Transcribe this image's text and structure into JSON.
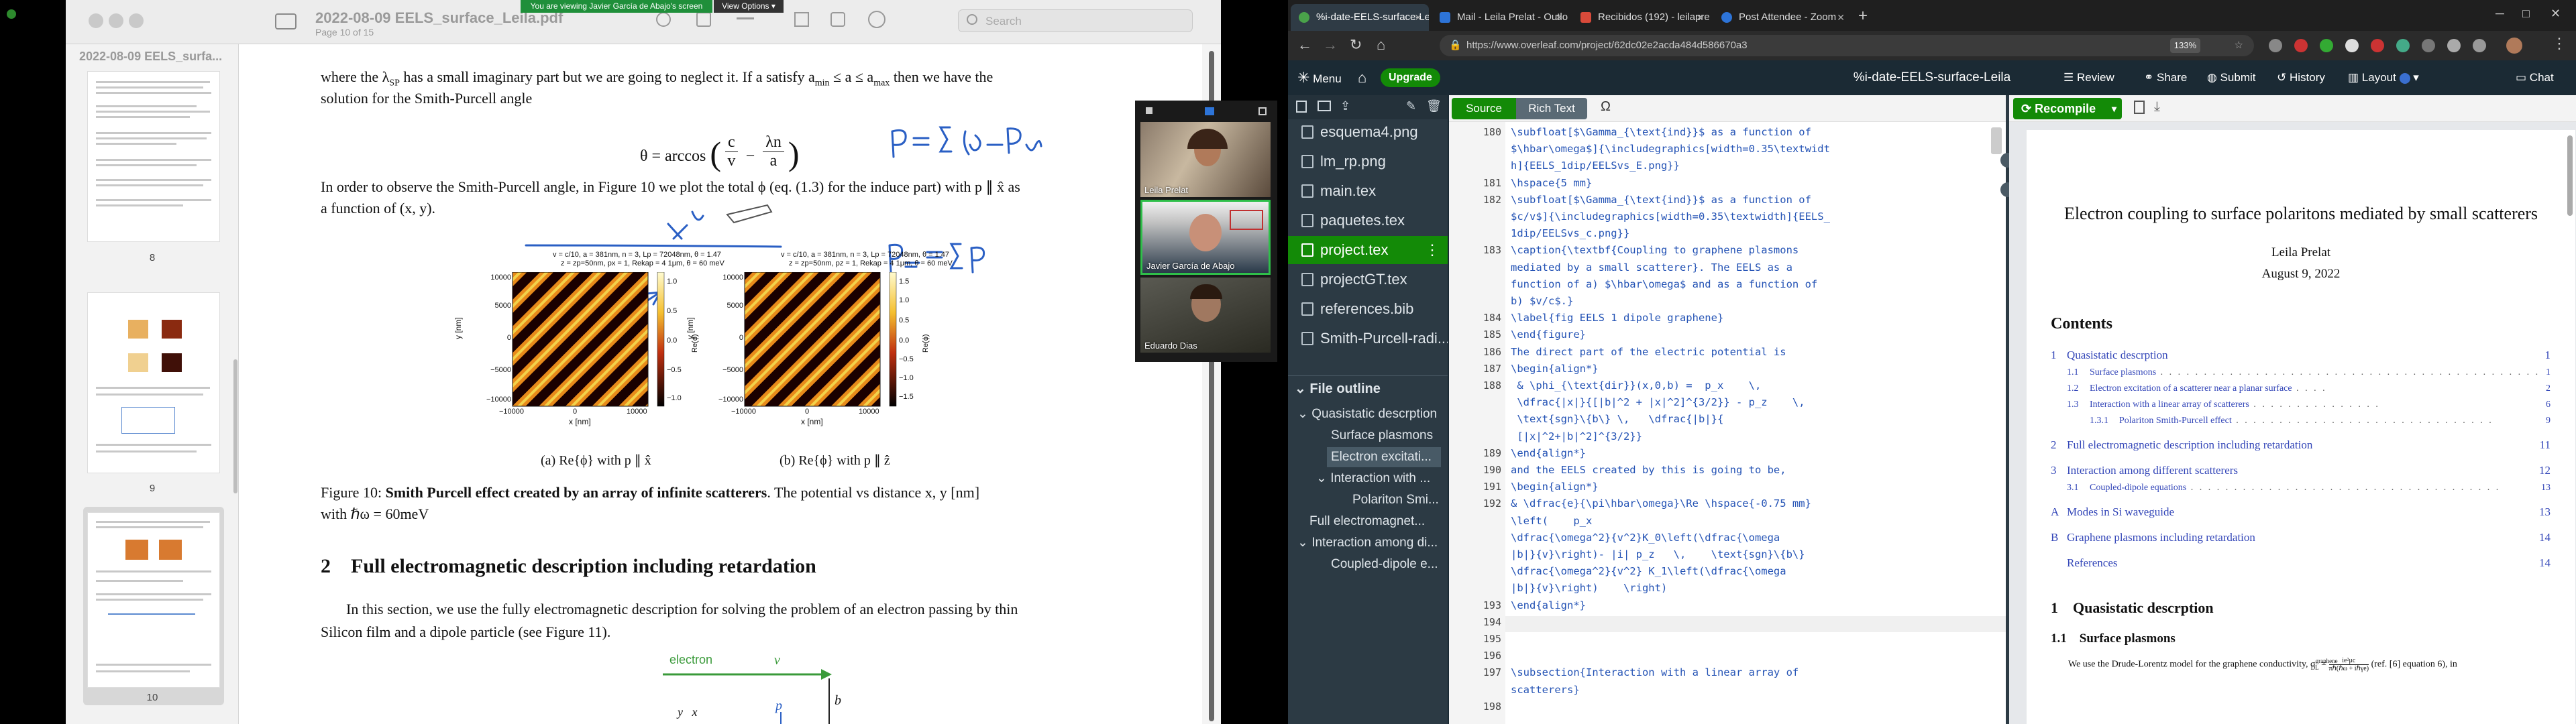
{
  "pdf": {
    "title": "2022-08-09 EELS_surface_Leila.pdf",
    "subtitle": "Page 10 of 15",
    "search_placeholder": "Search",
    "sidebar_title": "2022-08-09 EELS_surfa...",
    "thumb_labels": [
      "8",
      "9",
      "10"
    ],
    "page": {
      "p1": "where the λ",
      "p1b": "SP",
      "p1c": " has a small imaginary part but we are going to neglect it. If a satisfy a",
      "p1d": "min",
      "p1e": " ≤ a ≤ a",
      "p1f": "max",
      "p1g": " then we have the",
      "p2": "solution for the Smith-Purcell angle",
      "eq_lhs": "θ = arccos",
      "eq_frac1_num": "c",
      "eq_frac1_den": "v",
      "eq_minus": "−",
      "eq_frac2_num": "λn",
      "eq_frac2_den": "a",
      "p3": "In order to observe the Smith-Purcell angle, in Figure 10 we plot the total ϕ (eq. (1.3) for the induce part) with p ∥ x̂ as",
      "p4": "a function of (x, y).",
      "plot_a_title1": "v = c/10, a = 381nm, n = 3, Lp = 72048nm, θ = 1.47",
      "plot_a_title2": "z = zp=50nm, px = 1, Rekap = 4 1μm, θ = 60 meV",
      "plot_b_title1": "v = c/10, a = 381nm, n = 3, Lp = 72048nm, θ = 1.47",
      "plot_b_title2": "z = zp=50nm, pz = 1, Rekap = 4 1μm, θ = 60 meV",
      "yticks": [
        "10000",
        "5000",
        "0",
        "−5000",
        "−10000"
      ],
      "xticks": [
        "−10000",
        "0",
        "10000"
      ],
      "cbar_a": [
        "1.0",
        "0.5",
        "0.0",
        "−0.5",
        "−1.0"
      ],
      "cbar_b": [
        "1.5",
        "1.0",
        "0.5",
        "0.0",
        "−0.5",
        "−1.0",
        "−1.5"
      ],
      "cbar_label": "Re(ϕ)",
      "ylabel": "y [nm]",
      "xlabel": "x [nm]",
      "cap_a": "(a) Re{ϕ} with p ∥ x̂",
      "cap_b": "(b) Re{ϕ} with p ∥ ẑ",
      "fig_lead": "Figure 10: ",
      "fig_bold": "Smith Purcell effect created by an array of infinite scatterers",
      "fig_rest": ". The potential vs distance x, y [nm]",
      "fig_line2": "with ℏω = 60meV",
      "section": "2    Full electromagnetic description including retardation",
      "p5": "In this section, we use the fully electromagnetic description for solving the problem of an electron passing by thin",
      "p6": "Silicon film and a dipole particle (see Figure 11).",
      "fig11_electron": "electron",
      "fig11_v": "v",
      "fig11_b": "b",
      "fig11_p": "p",
      "fig11_yx": "y   x"
    }
  },
  "zoom": {
    "banner": "You are viewing Javier García de Abajo's screen",
    "view_options": "View Options ▾",
    "participants": [
      "Leila Prelat",
      "Javier García de Abajo",
      "Eduardo Dias"
    ]
  },
  "browser": {
    "tabs": [
      "%i-date-EELS-surface-Le",
      "Mail - Leila Prelat - Outlo",
      "Recibidos (192) - leilapre",
      "Post Attendee - Zoom"
    ],
    "url": "https://www.overleaf.com/project/62dc02e2acda484d586670a3",
    "zoom_level": "133%"
  },
  "overleaf": {
    "menu": "Menu",
    "upgrade": "Upgrade",
    "project_title": "%i-date-EELS-surface-Leila",
    "review": "Review",
    "share": "Share",
    "submit": "Submit",
    "history": "History",
    "layout": "Layout",
    "chat": "Chat",
    "source": "Source",
    "rich_text": "Rich Text",
    "omega": "Ω",
    "recompile": "Recompile",
    "files": [
      "esquema4.png",
      "lm_rp.png",
      "main.tex",
      "paquetes.tex",
      "project.tex",
      "projectGT.tex",
      "references.bib",
      "Smith-Purcell-radi..."
    ],
    "file_outline": "File outline",
    "outline": [
      "Quasistatic descrption",
      "Surface plasmons",
      "Electron excitati...",
      "Interaction with ...",
      "Polariton Smi...",
      "Full electromagnet...",
      "Interaction among di...",
      "Coupled-dipole e..."
    ]
  },
  "code": {
    "lines": [
      {
        "n": "180",
        "t": "\\subfloat[$\\Gamma_{\\text{ind}}$ as a function of"
      },
      {
        "n": "",
        "t": "$\\hbar\\omega$]{\\includegraphics[width=0.35\\textwidt"
      },
      {
        "n": "",
        "t": "h]{EELS_1dip/EELSvs_E.png}}"
      },
      {
        "n": "181",
        "t": "\\hspace{5 mm}"
      },
      {
        "n": "182",
        "t": "\\subfloat[$\\Gamma_{\\text{ind}}$ as a function of"
      },
      {
        "n": "",
        "t": "$c/v$]{\\includegraphics[width=0.35\\textwidth]{EELS_"
      },
      {
        "n": "",
        "t": "1dip/EELSvs_c.png}}"
      },
      {
        "n": "183",
        "t": "\\caption{\\textbf{Coupling to graphene plasmons"
      },
      {
        "n": "",
        "t": "mediated by a small scatterer}. The EELS as a"
      },
      {
        "n": "",
        "t": "function of a) $\\hbar\\omega$ and as a function of"
      },
      {
        "n": "",
        "t": "b) $v/c$.}"
      },
      {
        "n": "184",
        "t": "\\label{fig EELS 1 dipole graphene}"
      },
      {
        "n": "185",
        "t": "\\end{figure}"
      },
      {
        "n": "186",
        "t": "The direct part of the electric potential is"
      },
      {
        "n": "187",
        "t": "\\begin{align*}"
      },
      {
        "n": "188",
        "t": " & \\phi_{\\text{dir}}(x,0,b) =  p_x    \\,"
      },
      {
        "n": "",
        "t": " \\dfrac{|x|}{[|b|^2 + |x|^2]^{3/2}} - p_z    \\,"
      },
      {
        "n": "",
        "t": " \\text{sgn}\\{b\\} \\,   \\dfrac{|b|}{"
      },
      {
        "n": "",
        "t": " [|x|^2+|b|^2]^{3/2}}"
      },
      {
        "n": "189",
        "t": "\\end{align*}"
      },
      {
        "n": "190",
        "t": "and the EELS created by this is going to be,"
      },
      {
        "n": "191",
        "t": "\\begin{align*}"
      },
      {
        "n": "192",
        "t": "& \\dfrac{e}{\\pi\\hbar\\omega}\\Re \\hspace{-0.75 mm}"
      },
      {
        "n": "",
        "t": "\\left(    p_x"
      },
      {
        "n": "",
        "t": "\\dfrac{\\omega^2}{v^2}K_0\\left(\\dfrac{\\omega"
      },
      {
        "n": "",
        "t": "|b|}{v}\\right)- |i| p_z   \\,    \\text{sgn}\\{b\\}"
      },
      {
        "n": "",
        "t": "\\dfrac{\\omega^2}{v^2} K_1\\left(\\dfrac{\\omega"
      },
      {
        "n": "",
        "t": "|b|}{v}\\right)    \\right)"
      },
      {
        "n": "193",
        "t": "\\end{align*}"
      },
      {
        "n": "194",
        "t": ""
      },
      {
        "n": "195",
        "t": ""
      },
      {
        "n": "196",
        "t": ""
      },
      {
        "n": "197",
        "t": "\\subsection{Interaction with a linear array of"
      },
      {
        "n": "",
        "t": "scatterers}"
      },
      {
        "n": "198",
        "t": ""
      }
    ]
  },
  "preview": {
    "title": "Electron coupling to surface polaritons mediated by small scatterers",
    "author": "Leila Prelat",
    "date": "August 9, 2022",
    "contents": "Contents",
    "toc": [
      {
        "num": "1",
        "t": "Quasistatic descrption",
        "p": "1",
        "lvl": 0
      },
      {
        "num": "1.1",
        "t": "Surface plasmons",
        "p": "1",
        "lvl": 1
      },
      {
        "num": "1.2",
        "t": "Electron excitation of a scatterer near a planar surface",
        "p": "2",
        "lvl": 1
      },
      {
        "num": "1.3",
        "t": "Interaction with a linear array of scatterers",
        "p": "6",
        "lvl": 1
      },
      {
        "num": "1.3.1",
        "t": "Polariton Smith-Purcell effect",
        "p": "9",
        "lvl": 2
      },
      {
        "num": "2",
        "t": "Full electromagnetic description including retardation",
        "p": "11",
        "lvl": 0
      },
      {
        "num": "3",
        "t": "Interaction among different scatterers",
        "p": "12",
        "lvl": 0
      },
      {
        "num": "3.1",
        "t": "Coupled-dipole equations",
        "p": "13",
        "lvl": 1
      },
      {
        "num": "A",
        "t": "Modes in Si waveguide",
        "p": "13",
        "lvl": 0
      },
      {
        "num": "B",
        "t": "Graphene plasmons including retardation",
        "p": "14",
        "lvl": 0
      },
      {
        "num": "",
        "t": "References",
        "p": "14",
        "lvl": 0
      }
    ],
    "sec1": "1    Quasistatic descrption",
    "sec11": "1.1    Surface plasmons",
    "body": "We use the Drude-Lorentz model for the graphene conductivity, σ",
    "body_b": "graphene",
    "body_c": "DL",
    "body_d": " = ",
    "body_e": "ie²μc",
    "body_f": "πℏ(ℏω + iℏγe)",
    "body_g": "  (ref. [6] equation 6), in"
  }
}
